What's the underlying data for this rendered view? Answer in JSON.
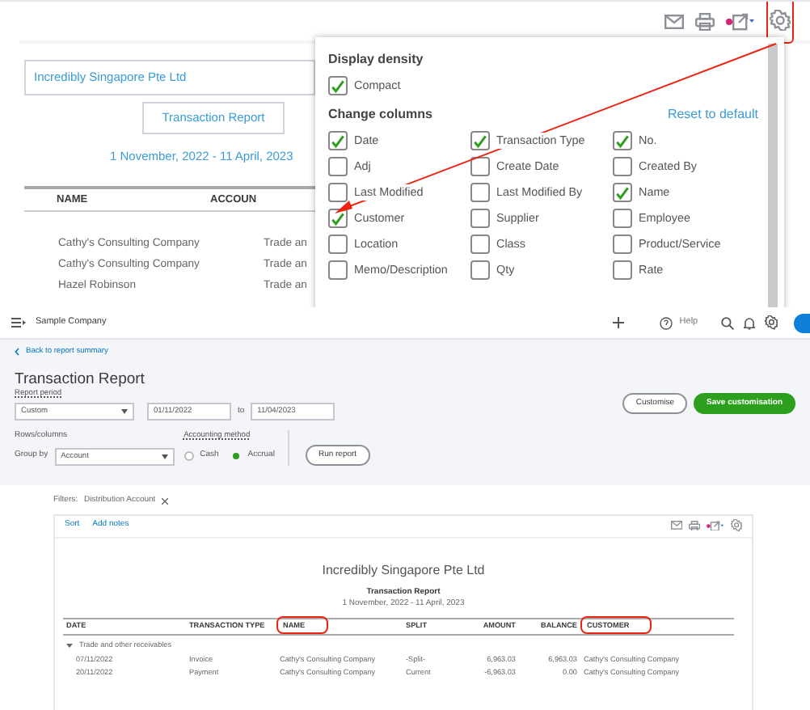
{
  "report_preview": {
    "company_field": {
      "value": "Incredibly Singapore Pte Ltd"
    },
    "title_field": {
      "value": "Transaction Report"
    },
    "date_range": "1 November, 2022 - 11 April, 2023",
    "columns": [
      "NAME",
      "ACCOUN"
    ],
    "rows": [
      {
        "cells": [
          "Cathy's Consulting Company",
          "Trade an"
        ]
      },
      {
        "cells": [
          "Cathy's Consulting Company",
          "Trade an"
        ]
      },
      {
        "cells": [
          "Hazel Robinson",
          "Trade an"
        ]
      }
    ]
  },
  "settings_panel": {
    "sections": [
      {
        "title": "Display density",
        "options": [
          {
            "label": "Compact",
            "checked": true
          }
        ]
      },
      {
        "title": "Change columns",
        "link": "Reset to default",
        "options": [
          {
            "label": "Date",
            "checked": true
          },
          {
            "label": "Transaction Type",
            "checked": true
          },
          {
            "label": "No.",
            "checked": true
          },
          {
            "label": "Adj",
            "checked": false
          },
          {
            "label": "Create Date",
            "checked": false
          },
          {
            "label": "Created By",
            "checked": false
          },
          {
            "label": "Last Modified",
            "checked": false
          },
          {
            "label": "Last Modified By",
            "checked": false
          },
          {
            "label": "Name",
            "checked": true
          },
          {
            "label": "Customer",
            "checked": true
          },
          {
            "label": "Supplier",
            "checked": false
          },
          {
            "label": "Employee",
            "checked": false
          },
          {
            "label": "Location",
            "checked": false
          },
          {
            "label": "Class",
            "checked": false
          },
          {
            "label": "Product/Service",
            "checked": false
          },
          {
            "label": "Memo/Description",
            "checked": false
          },
          {
            "label": "Qty",
            "checked": false
          },
          {
            "label": "Rate",
            "checked": false
          }
        ]
      }
    ]
  },
  "app_bar": {
    "company": "Sample Company",
    "help": "Help"
  },
  "report_page": {
    "back_link": "Back to report summary",
    "title": "Transaction Report",
    "report_period": {
      "label": "Report period",
      "period": "Custom",
      "from": "01/11/2022",
      "to_label": "to",
      "to": "11/04/2023"
    },
    "rows_columns": {
      "label": "Rows/columns",
      "group_by_label": "Group by",
      "group_by": "Account"
    },
    "accounting_method": {
      "label": "Accounting method",
      "options": [
        {
          "label": "Cash",
          "selected": false
        },
        {
          "label": "Accrual",
          "selected": true
        }
      ]
    },
    "run_button": "Run report",
    "customise_button": "Customise",
    "save_button": "Save customisation",
    "filters": {
      "label": "Filters:",
      "chips": [
        "Distribution Account"
      ]
    }
  },
  "report": {
    "sort": "Sort",
    "add_notes": "Add notes",
    "company": "Incredibly Singapore Pte Ltd",
    "title": "Transaction Report",
    "date_range": "1 November, 2022 - 11 April, 2023",
    "columns": [
      {
        "label": "DATE",
        "highlighted": false
      },
      {
        "label": "TRANSACTION TYPE",
        "highlighted": false
      },
      {
        "label": "NAME",
        "highlighted": true
      },
      {
        "label": "SPLIT",
        "highlighted": false
      },
      {
        "label": "AMOUNT",
        "highlighted": false
      },
      {
        "label": "BALANCE",
        "highlighted": false
      },
      {
        "label": "CUSTOMER",
        "highlighted": true
      }
    ],
    "groups": [
      {
        "name": "Trade and other receivables",
        "expanded": true,
        "rows": [
          {
            "cells": [
              "07/11/2022",
              "Invoice",
              "Cathy's Consulting Company",
              "-Split-",
              "6,963.03",
              "6,963.03",
              "Cathy's Consulting Company"
            ]
          },
          {
            "cells": [
              "20/11/2022",
              "Payment",
              "Cathy's Consulting Company",
              "Current",
              "-6,963.03",
              "0.00",
              "Cathy's Consulting Company"
            ]
          }
        ]
      }
    ]
  }
}
